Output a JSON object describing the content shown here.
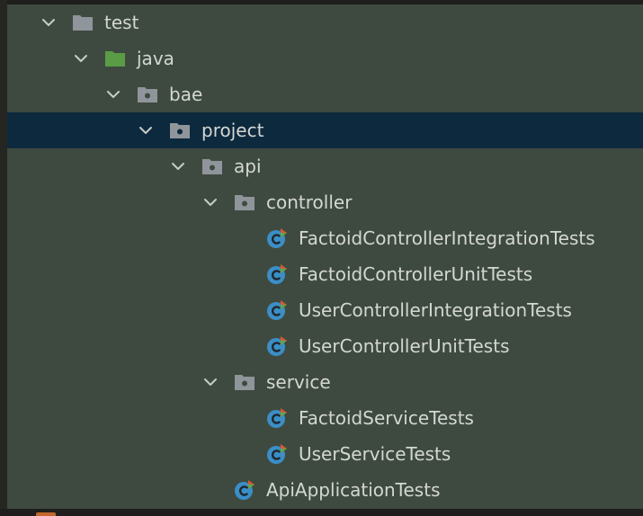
{
  "project_tree": {
    "items": [
      {
        "label": "test",
        "type": "folder"
      },
      {
        "label": "java",
        "type": "source-root"
      },
      {
        "label": "bae",
        "type": "package"
      },
      {
        "label": "project",
        "type": "package",
        "selected": true
      },
      {
        "label": "api",
        "type": "package"
      },
      {
        "label": "controller",
        "type": "package"
      },
      {
        "label": "FactoidControllerIntegrationTests",
        "type": "test-class"
      },
      {
        "label": "FactoidControllerUnitTests",
        "type": "test-class"
      },
      {
        "label": "UserControllerIntegrationTests",
        "type": "test-class"
      },
      {
        "label": "UserControllerUnitTests",
        "type": "test-class"
      },
      {
        "label": "service",
        "type": "package"
      },
      {
        "label": "FactoidServiceTests",
        "type": "test-class"
      },
      {
        "label": "UserServiceTests",
        "type": "test-class"
      },
      {
        "label": "ApiApplicationTests",
        "type": "test-class"
      }
    ]
  },
  "icons": {
    "expanded": "chevron-down-icon",
    "folder": "folder-icon",
    "source_root": "source-root-folder-icon",
    "package": "package-folder-icon",
    "test_class": "test-class-icon"
  },
  "colors": {
    "panel_background": "#3e4a40",
    "selection": "#0d293e",
    "text": "#d4d7d2",
    "folder": "#8f959a",
    "source_root_folder": "#5a9c46",
    "class_icon": "#3b8ec6",
    "test_marker": "#d45b30"
  }
}
